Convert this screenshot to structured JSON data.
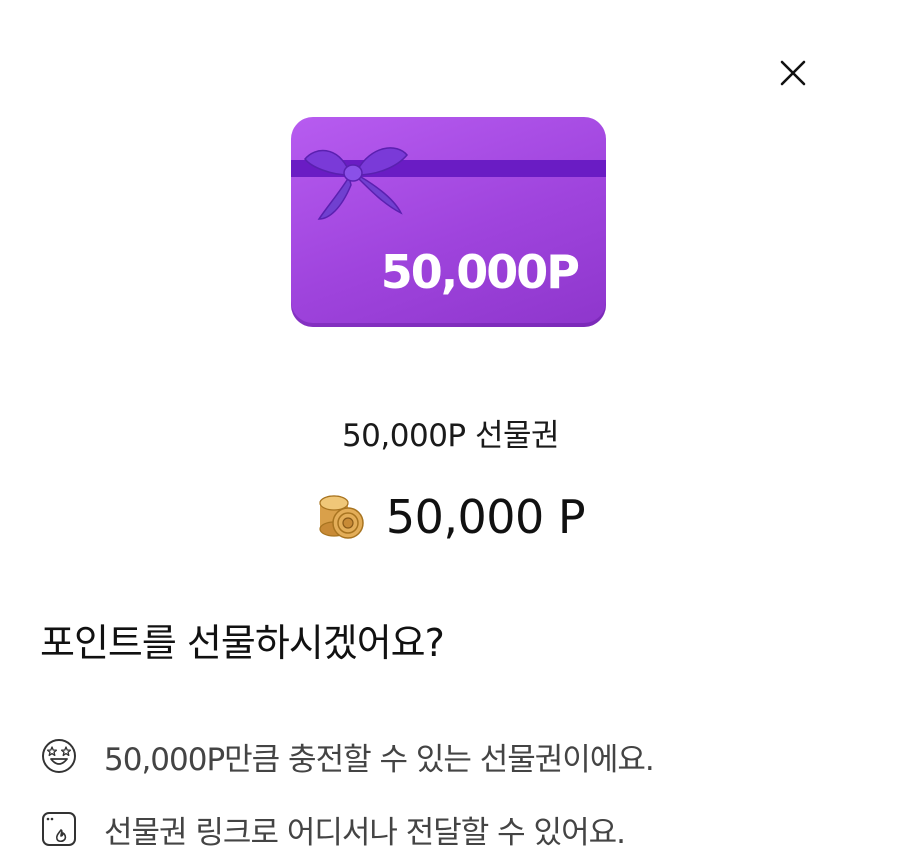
{
  "header": {
    "close_icon": "close-icon"
  },
  "card": {
    "amount_label": "50,000P",
    "color": "#a64ee3",
    "ribbon_color": "#6a1cc4"
  },
  "product": {
    "name": "50,000P 선물권"
  },
  "price": {
    "icon": "coin-stack-icon",
    "text": "50,000 P"
  },
  "question": "포인트를 선물하시겠어요?",
  "info_items": [
    {
      "icon": "star-eyes-face-icon",
      "text": "50,000P만큼 충전할 수 있는 선물권이에요."
    },
    {
      "icon": "link-window-icon",
      "text": "선물권 링크로 어디서나 전달할 수 있어요."
    }
  ]
}
